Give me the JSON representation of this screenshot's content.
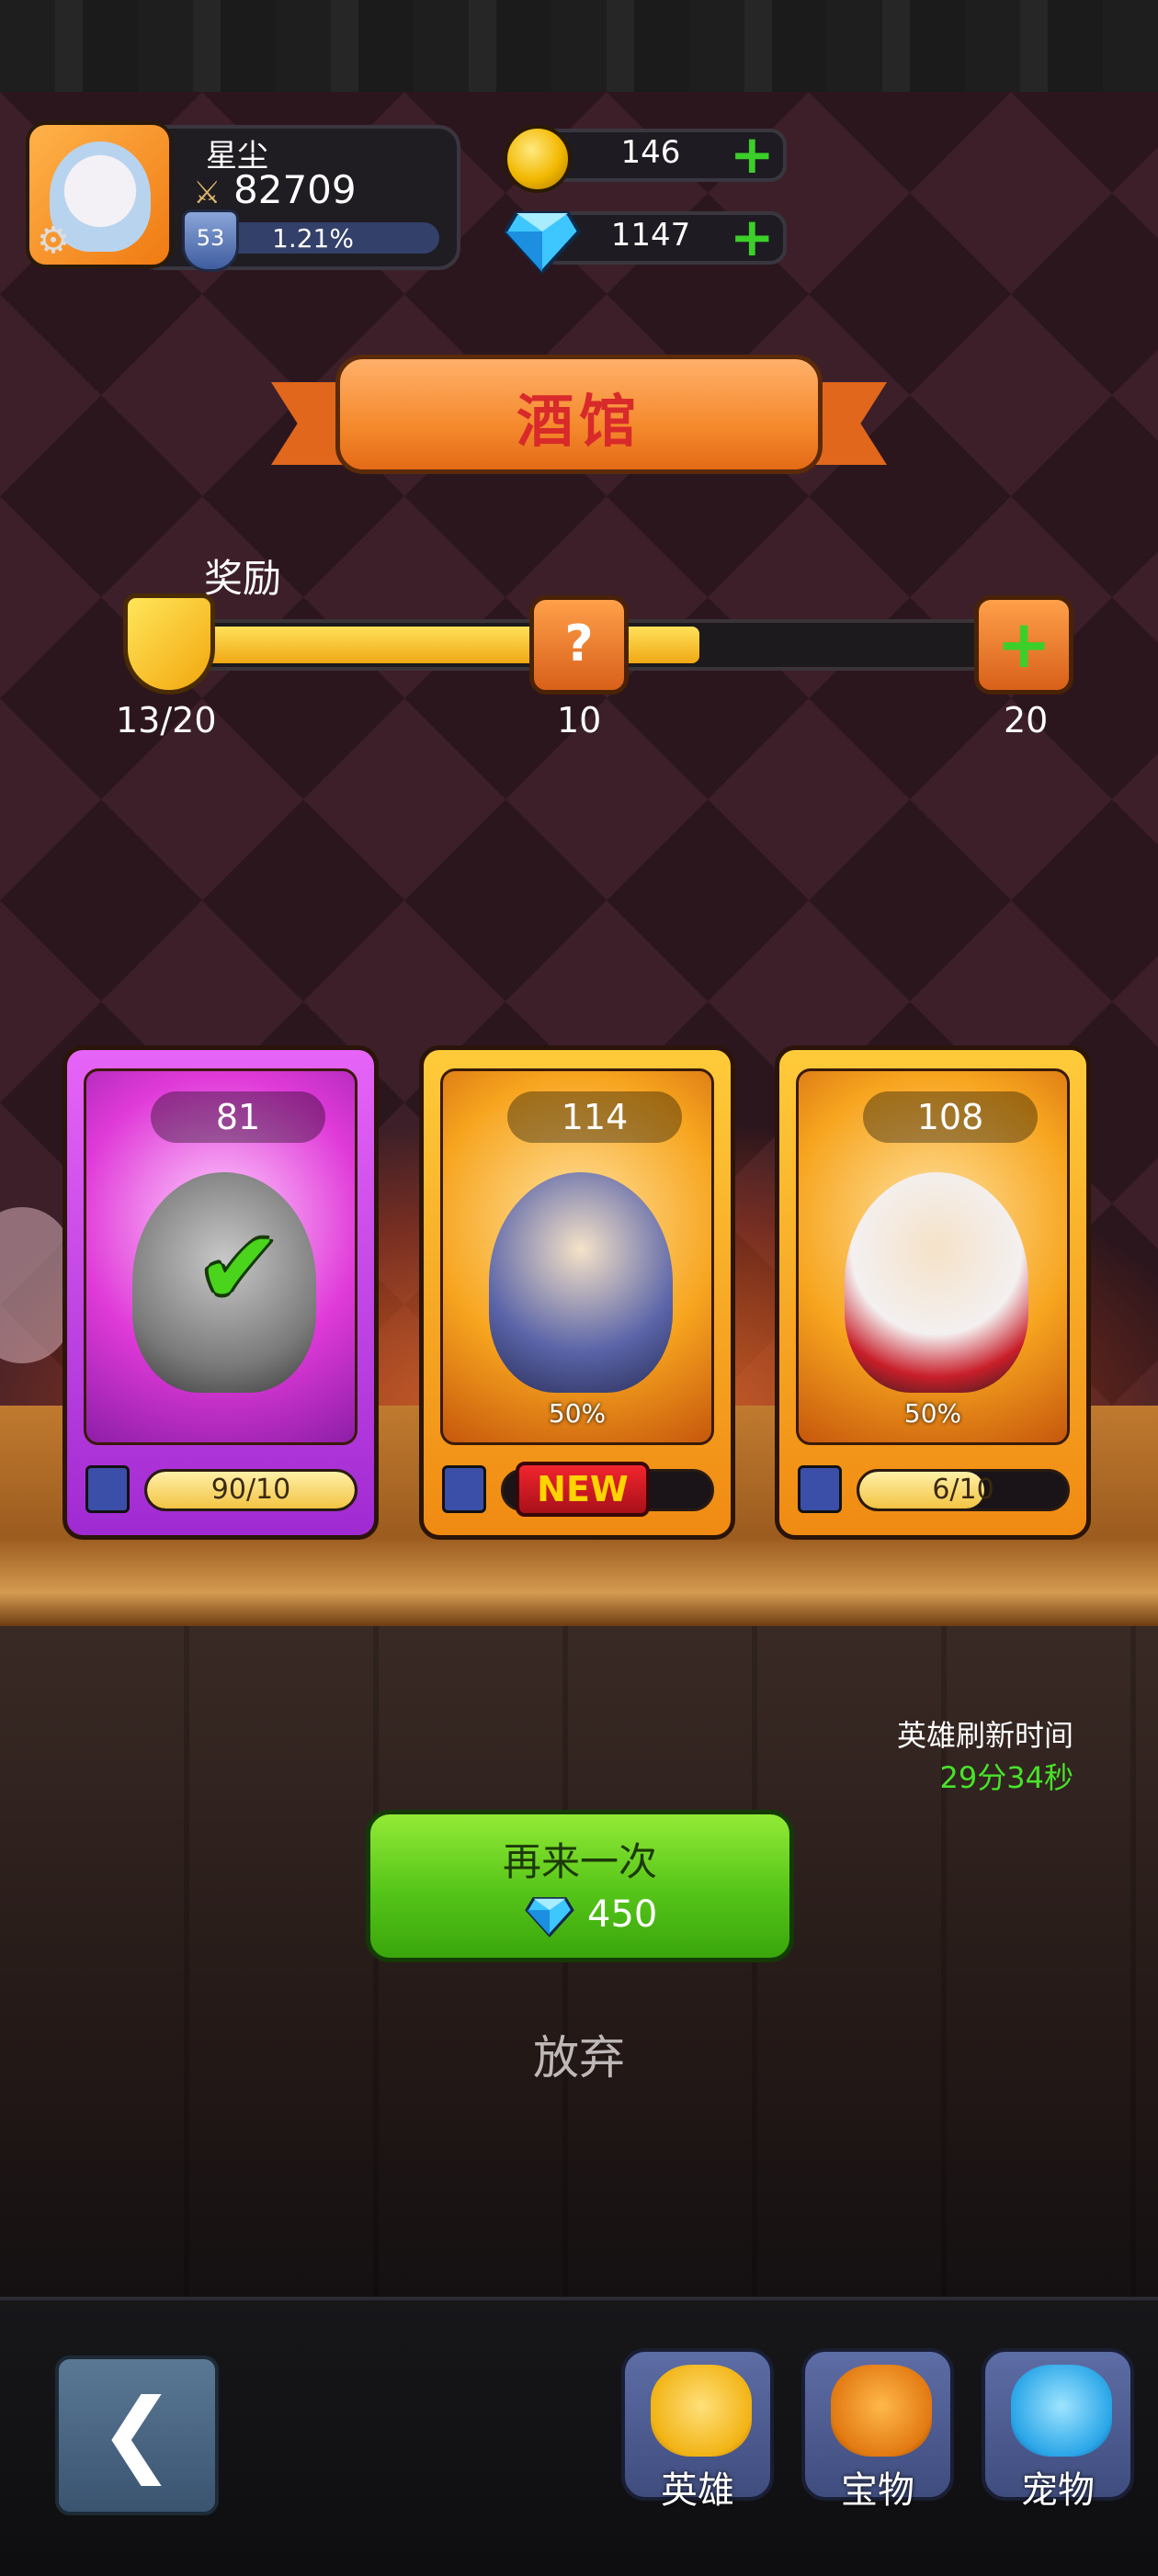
{
  "player": {
    "name": "星尘",
    "power": "82709",
    "level": "53",
    "rank_pct": "1.21%"
  },
  "currencies": {
    "gold": "146",
    "gems": "1147"
  },
  "banner": {
    "title": "酒馆"
  },
  "reward": {
    "label": "奖励",
    "progress_text": "13/20",
    "milestone_1": "10",
    "milestone_2": "20",
    "progress_fraction": 0.65
  },
  "cards": [
    {
      "hp": "81",
      "progress": "90/10",
      "progress_fraction": 1.0,
      "selected": true
    },
    {
      "hp": "114",
      "percent": "50%",
      "badge": "NEW"
    },
    {
      "hp": "108",
      "percent": "50%",
      "progress": "6/10",
      "progress_fraction": 0.6
    }
  ],
  "refresh": {
    "label": "英雄刷新时间",
    "time": "29分34秒"
  },
  "retry": {
    "label": "再来一次",
    "cost": "450"
  },
  "give_up": "放弃",
  "nav": {
    "heroes": "英雄",
    "treasures": "宝物",
    "pets": "宠物"
  },
  "colors": {
    "accent_green": "#48e22a",
    "gold": "#f2b800",
    "purple_card": "#a02ad2",
    "orange_card": "#f08a12"
  }
}
